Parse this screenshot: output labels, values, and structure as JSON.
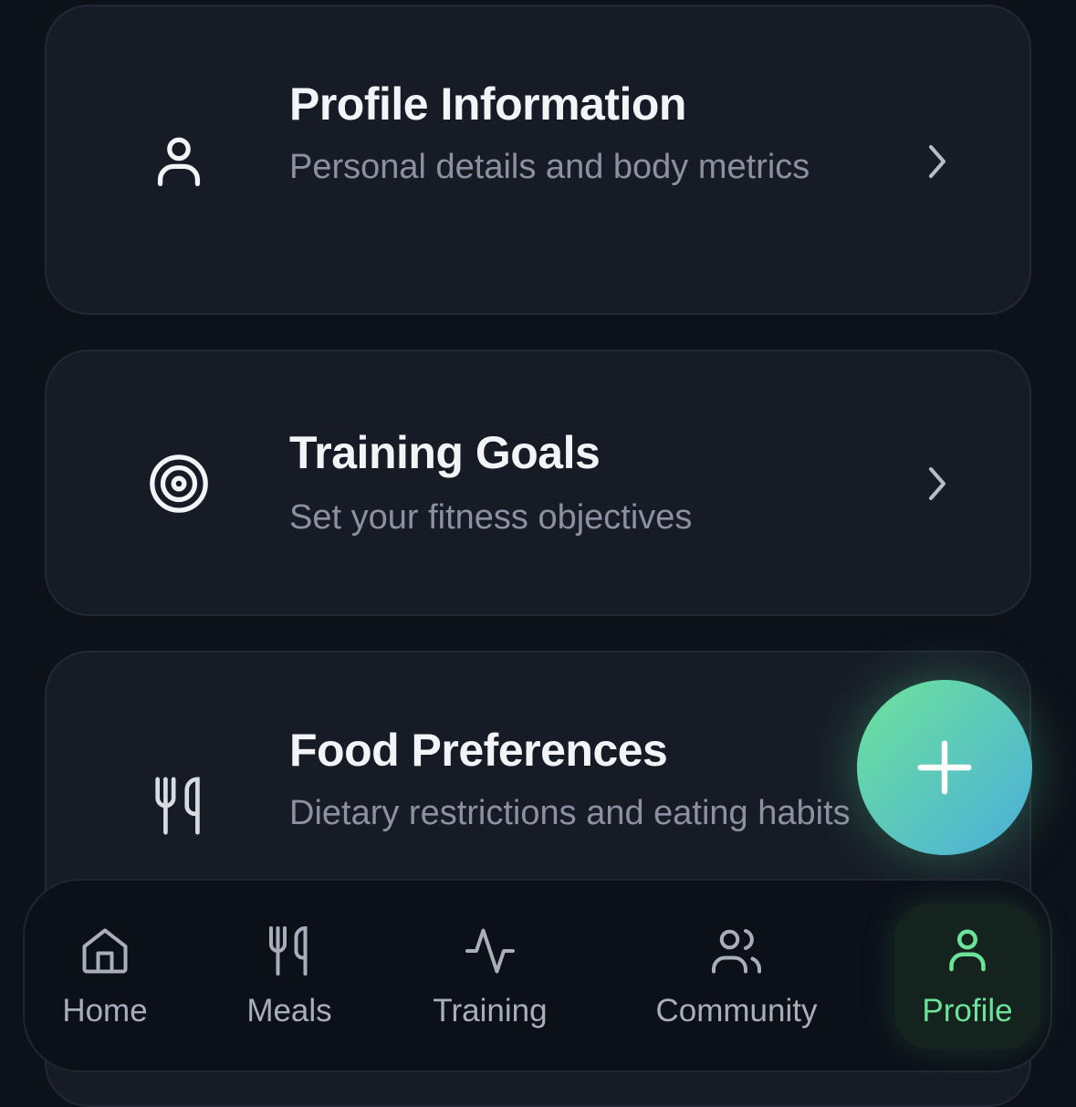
{
  "cards": [
    {
      "title": "Profile Information",
      "subtitle": "Personal details and body metrics",
      "icon": "user-icon"
    },
    {
      "title": "Training Goals",
      "subtitle": "Set your fitness objectives",
      "icon": "target-icon"
    },
    {
      "title": "Food Preferences",
      "subtitle": "Dietary restrictions and eating habits",
      "icon": "utensils-icon"
    }
  ],
  "fab": {
    "icon": "plus-icon"
  },
  "nav": {
    "items": [
      {
        "label": "Home",
        "icon": "home-icon"
      },
      {
        "label": "Meals",
        "icon": "utensils-icon"
      },
      {
        "label": "Training",
        "icon": "activity-icon"
      },
      {
        "label": "Community",
        "icon": "users-icon"
      },
      {
        "label": "Profile",
        "icon": "user-icon",
        "active": true
      }
    ]
  },
  "colors": {
    "accent": "#6de39a",
    "accent2": "#4aaedb",
    "background": "#0d111a",
    "card": "#161b26"
  }
}
